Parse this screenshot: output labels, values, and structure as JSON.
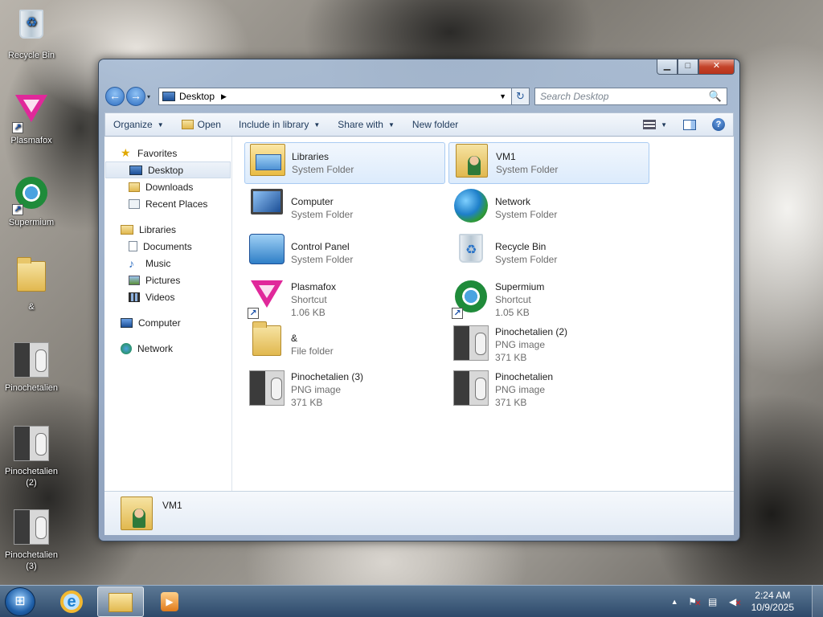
{
  "desktop": {
    "icons": [
      {
        "label": "Recycle Bin",
        "icon": "recycle-bin-icon"
      },
      {
        "label": "Plasmafox",
        "icon": "plasmafox-icon",
        "shortcut": true
      },
      {
        "label": "Supermium",
        "icon": "supermium-icon",
        "shortcut": true
      },
      {
        "label": "&",
        "icon": "folder-icon"
      },
      {
        "label": "Pinochetalien",
        "icon": "png-thumbnail-icon"
      },
      {
        "label": "Pinochetalien (2)",
        "icon": "png-thumbnail-icon"
      },
      {
        "label": "Pinochetalien (3)",
        "icon": "png-thumbnail-icon"
      }
    ]
  },
  "window": {
    "caption": {
      "minimize": "▁",
      "maximize": "□",
      "close": "✕"
    },
    "address": {
      "back": "←",
      "forward": "→",
      "history_caret": "▾",
      "location": "Desktop",
      "separator": "▶",
      "dropdown": "▼",
      "refresh": "↻"
    },
    "search": {
      "placeholder": "Search Desktop",
      "icon": "🔍"
    },
    "toolbar": {
      "organize": "Organize",
      "open": "Open",
      "include_in_library": "Include in library",
      "share_with": "Share with",
      "new_folder": "New folder",
      "caret": "▼",
      "help": "?"
    },
    "nav": {
      "favorites": "Favorites",
      "desktop": "Desktop",
      "downloads": "Downloads",
      "recent_places": "Recent Places",
      "libraries": "Libraries",
      "documents": "Documents",
      "music": "Music",
      "pictures": "Pictures",
      "videos": "Videos",
      "computer": "Computer",
      "network": "Network"
    },
    "items": [
      {
        "name": "Libraries",
        "type": "System Folder",
        "icon": "libraries-icon",
        "selected": true
      },
      {
        "name": "VM1",
        "type": "System Folder",
        "icon": "user-folder-icon",
        "selected": true
      },
      {
        "name": "Computer",
        "type": "System Folder",
        "icon": "computer-icon"
      },
      {
        "name": "Network",
        "type": "System Folder",
        "icon": "network-globe-icon"
      },
      {
        "name": "Control Panel",
        "type": "System Folder",
        "icon": "control-panel-icon"
      },
      {
        "name": "Recycle Bin",
        "type": "System Folder",
        "icon": "recycle-bin-icon"
      },
      {
        "name": "Plasmafox",
        "type": "Shortcut",
        "size": "1.06 KB",
        "icon": "plasmafox-icon"
      },
      {
        "name": "Supermium",
        "type": "Shortcut",
        "size": "1.05 KB",
        "icon": "supermium-icon"
      },
      {
        "name": "&",
        "type": "File folder",
        "icon": "folder-icon"
      },
      {
        "name": "Pinochetalien (2)",
        "type": "PNG image",
        "size": "371 KB",
        "icon": "png-thumbnail-icon"
      },
      {
        "name": "Pinochetalien (3)",
        "type": "PNG image",
        "size": "371 KB",
        "icon": "png-thumbnail-icon"
      },
      {
        "name": "Pinochetalien",
        "type": "PNG image",
        "size": "371 KB",
        "icon": "png-thumbnail-icon"
      }
    ],
    "details": {
      "name": "VM1"
    }
  },
  "taskbar": {
    "start": "⊞",
    "ie": "e",
    "media": "▶",
    "tray": {
      "arrow": "▲",
      "flag": "⚑",
      "network": "▤",
      "volume": "◀",
      "x": "✕"
    },
    "clock": {
      "time": "2:24 AM",
      "date": "10/9/2025"
    }
  }
}
